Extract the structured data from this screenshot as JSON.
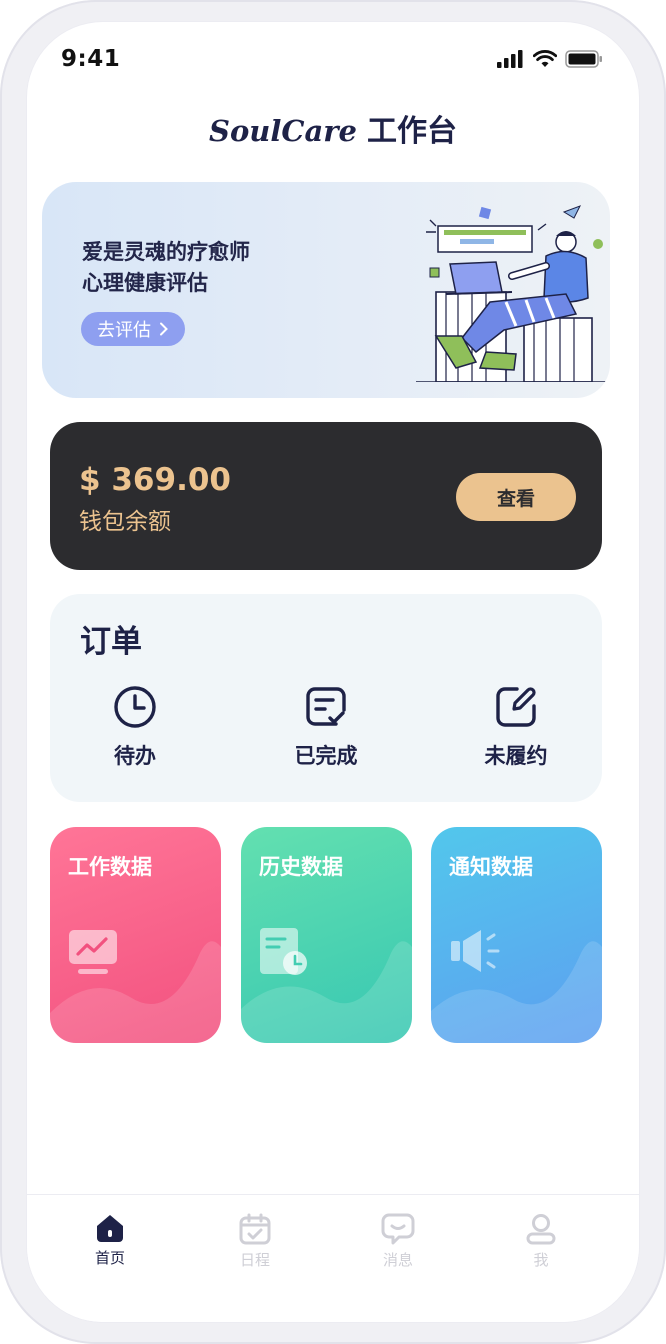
{
  "status_bar": {
    "time": "9:41"
  },
  "header": {
    "brand": "SoulCare",
    "title_suffix": "工作台"
  },
  "banner": {
    "line1": "爱是灵魂的疗愈师",
    "line2": "心理健康评估",
    "button_label": "去评估"
  },
  "wallet": {
    "amount": "$ 369.00",
    "label": "钱包余额",
    "button_label": "查看"
  },
  "orders": {
    "title": "订单",
    "items": [
      {
        "label": "待办",
        "icon": "clock-icon"
      },
      {
        "label": "已完成",
        "icon": "checklist-icon"
      },
      {
        "label": "未履约",
        "icon": "edit-icon"
      }
    ]
  },
  "data_cards": [
    {
      "title": "工作数据",
      "icon": "monitor-chart-icon",
      "color_start": "#ff7597",
      "color_end": "#f2517f"
    },
    {
      "title": "历史数据",
      "icon": "document-clock-icon",
      "color_start": "#63e0b0",
      "color_end": "#37c7b2"
    },
    {
      "title": "通知数据",
      "icon": "megaphone-icon",
      "color_start": "#52c7ec",
      "color_end": "#5d9ff0"
    }
  ],
  "tabbar": {
    "items": [
      {
        "label": "首页",
        "icon": "home-icon",
        "active": true
      },
      {
        "label": "日程",
        "icon": "calendar-icon",
        "active": false
      },
      {
        "label": "消息",
        "icon": "chat-icon",
        "active": false
      },
      {
        "label": "我",
        "icon": "user-icon",
        "active": false
      }
    ]
  },
  "colors": {
    "accent_dark": "#1e2247",
    "gold": "#ecc38f",
    "banner_button": "#8e9ff0"
  }
}
